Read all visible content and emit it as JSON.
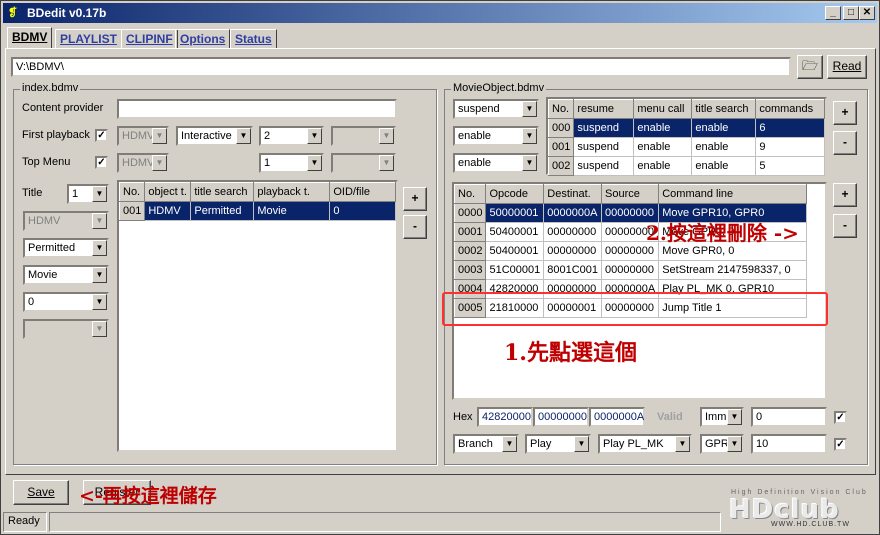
{
  "window": {
    "title": "BDedit v0.17b"
  },
  "tabs": [
    "BDMV",
    "PLAYLIST",
    "CLIPINF",
    "Options",
    "Status"
  ],
  "path": {
    "value": "V:\\BDMV\\",
    "read_label": "Read"
  },
  "index": {
    "legend": "index.bdmv",
    "content_provider_label": "Content provider",
    "content_provider_value": "",
    "first_playback_label": "First playback",
    "top_menu_label": "Top Menu",
    "first_playback": {
      "checked": "✓",
      "type": "HDMV",
      "mode": "Interactive",
      "num": "2",
      "extra": ""
    },
    "top_menu": {
      "checked": "✓",
      "type": "HDMV",
      "num": "1",
      "extra": ""
    },
    "title_label": "Title",
    "title_value": "1",
    "title_type": "HDMV",
    "title_search": "Permitted",
    "title_playback": "Movie",
    "title_oid": "0",
    "title_extra": "",
    "table": {
      "headers": [
        "No.",
        "object t.",
        "title search",
        "playback t.",
        "OID/file"
      ],
      "rows": [
        [
          "001",
          "HDMV",
          "Permitted",
          "Movie",
          "0"
        ]
      ]
    }
  },
  "movieobject": {
    "legend": "MovieObject.bdmv",
    "combos": [
      "suspend",
      "enable",
      "enable"
    ],
    "obj_table": {
      "headers": [
        "No.",
        "resume",
        "menu call",
        "title search",
        "commands"
      ],
      "rows": [
        [
          "000",
          "suspend",
          "enable",
          "enable",
          "6"
        ],
        [
          "001",
          "suspend",
          "enable",
          "enable",
          "9"
        ],
        [
          "002",
          "suspend",
          "enable",
          "enable",
          "5"
        ]
      ]
    },
    "cmd_table": {
      "headers": [
        "No.",
        "Opcode",
        "Destinat.",
        "Source",
        "Command line"
      ],
      "rows": [
        [
          "0000",
          "50000001",
          "0000000A",
          "00000000",
          "Move GPR10, GPR0"
        ],
        [
          "0001",
          "50400001",
          "00000000",
          "00000000",
          "Move GPR0, 0"
        ],
        [
          "0002",
          "50400001",
          "00000000",
          "00000000",
          "Move GPR0, 0"
        ],
        [
          "0003",
          "51C00001",
          "8001C001",
          "00000000",
          "SetStream 2147598337, 0"
        ],
        [
          "0004",
          "42820000",
          "00000000",
          "0000000A",
          "Play PL_MK 0, GPR10"
        ],
        [
          "0005",
          "21810000",
          "00000001",
          "00000000",
          "Jump Title 1"
        ]
      ]
    },
    "hex_label": "Hex",
    "hex_values": [
      "42820000",
      "00000000",
      "0000000A"
    ],
    "valid_label": "Valid",
    "imm_value": "Imm",
    "imm_input": "0",
    "branch_values": [
      "Branch",
      "Play",
      "Play PL_MK",
      "GPR"
    ],
    "gpr_input": "10",
    "check_mark": "✓"
  },
  "buttons": {
    "plus": "+",
    "minus": "-",
    "save": "Save",
    "register": "Register"
  },
  "annotations": {
    "select_first": "1.先點選這個",
    "delete_here": "2.按這裡刪除 ->",
    "save_here": "<-再按這裡儲存"
  },
  "statusbar": {
    "text": "Ready"
  },
  "logo": {
    "tagline": "High Definition Vision Club",
    "brand": "HDclub",
    "url": "WWW.HD.CLUB.TW"
  }
}
